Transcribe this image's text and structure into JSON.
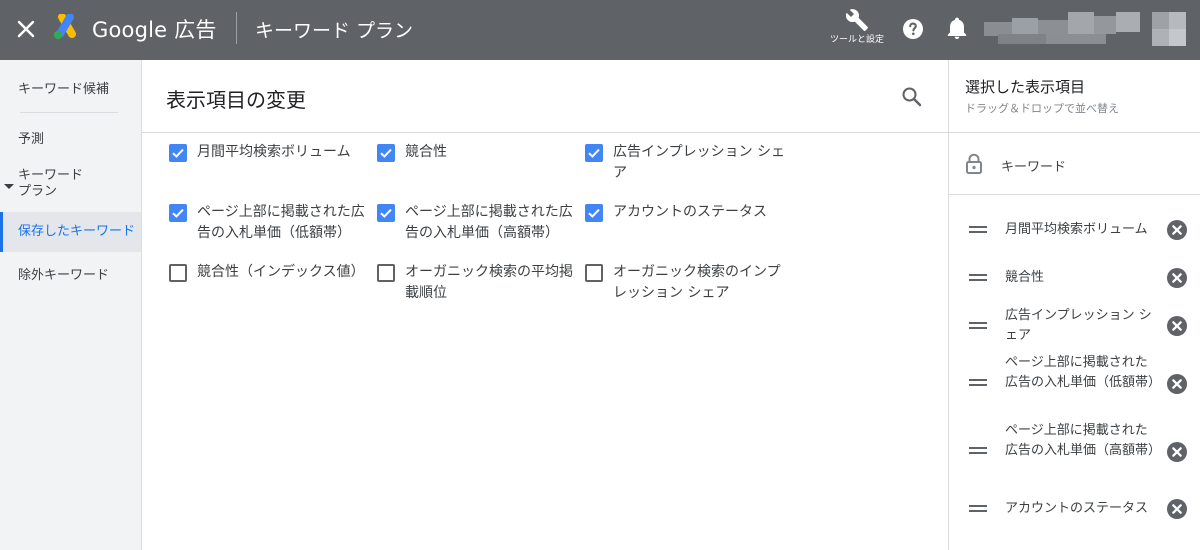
{
  "topbar": {
    "product": "Google 広告",
    "page_name": "キーワード プラン",
    "tools_label": "ツールと設定",
    "colors": {
      "bar": "#5f6368",
      "logo_blue": "#4285f4",
      "logo_yellow": "#fbbc04",
      "logo_green": "#34a853"
    }
  },
  "leftnav": {
    "items": [
      {
        "label": "キーワード候補"
      },
      {
        "label": "予測"
      },
      {
        "label": "キーワード\nプラン"
      },
      {
        "label": "保存したキーワード",
        "active": true
      },
      {
        "label": "除外キーワード"
      }
    ]
  },
  "main": {
    "title": "表示項目の変更",
    "options": [
      {
        "label": "月間平均検索ボリューム",
        "checked": true
      },
      {
        "label": "競合性",
        "checked": true
      },
      {
        "label": "広告インプレッション シェア",
        "checked": true
      },
      {
        "label": "ページ上部に掲載された広告の入札単価（低額帯）",
        "checked": true
      },
      {
        "label": "ページ上部に掲載された広告の入札単価（高額帯）",
        "checked": true
      },
      {
        "label": "アカウントのステータス",
        "checked": true
      },
      {
        "label": "競合性（インデックス値）",
        "checked": false
      },
      {
        "label": "オーガニック検索の平均掲載順位",
        "checked": false
      },
      {
        "label": "オーガニック検索のインプレッション シェア",
        "checked": false
      }
    ]
  },
  "selected": {
    "title": "選択した表示項目",
    "subtitle": "ドラッグ＆ドロップで並べ替え",
    "fixed_item": "キーワード",
    "items": [
      {
        "label": "月間平均検索ボリューム"
      },
      {
        "label": "競合性"
      },
      {
        "label": "広告インプレッション シェア"
      },
      {
        "label": "ページ上部に掲載された広告の入札単価（低額帯）"
      },
      {
        "label": "ページ上部に掲載された広告の入札単価（高額帯）"
      },
      {
        "label": "アカウントのステータス"
      }
    ]
  },
  "icons": [
    "close-icon",
    "google-ads-logo",
    "wrench-icon",
    "help-icon",
    "bell-icon",
    "search-icon",
    "lock-icon",
    "drag-handle-icon",
    "remove-icon",
    "checkbox-icon"
  ]
}
